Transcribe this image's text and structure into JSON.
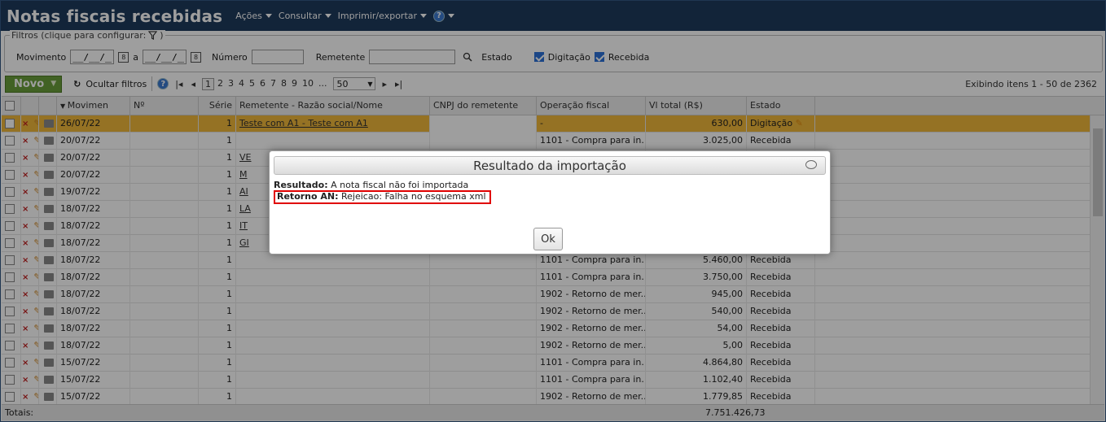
{
  "header": {
    "title": "Notas fiscais recebidas",
    "menus": [
      "Ações",
      "Consultar",
      "Imprimir/exportar"
    ],
    "help_icon": "question-circle-icon"
  },
  "filters": {
    "legend": "Filtros (clique para configurar:",
    "movimento_label": "Movimento",
    "date_from": "__/__/__",
    "a_label": "a",
    "date_to": "__/__/__",
    "numero_label": "Número",
    "numero_value": "",
    "remetente_label": "Remetente",
    "remetente_value": "",
    "estado_label": "Estado",
    "digitacao_label": "Digitação",
    "recebida_label": "Recebida",
    "digitacao_checked": true,
    "recebida_checked": true
  },
  "toolbar": {
    "novo_label": "Novo",
    "ocultar_label": "Ocultar filtros",
    "pages": [
      "1",
      "2",
      "3",
      "4",
      "5",
      "6",
      "7",
      "8",
      "9",
      "10",
      "..."
    ],
    "current_page": "1",
    "page_size": "50",
    "showing": "Exibindo itens 1 - 50 de 2362"
  },
  "table": {
    "headers": [
      "",
      "",
      "",
      "Movimen",
      "Nº",
      "Série",
      "Remetente - Razão social/Nome",
      "CNPJ do remetente",
      "Operação fiscal",
      "Vl total (R$)",
      "Estado"
    ],
    "rows": [
      {
        "date": "26/07/22",
        "serie": "1",
        "remetente": "Teste com A1 - Teste com A1",
        "cnpj": "",
        "operacao": "-",
        "valor": "630,00",
        "estado": "Digitação",
        "selected": true
      },
      {
        "date": "20/07/22",
        "serie": "1",
        "remetente": "",
        "cnpj": "",
        "operacao": "1101 - Compra para in...",
        "valor": "3.025,00",
        "estado": "Recebida"
      },
      {
        "date": "20/07/22",
        "serie": "1",
        "remetente": "VE",
        "cnpj": "",
        "operacao": "",
        "valor": "",
        "estado": ""
      },
      {
        "date": "20/07/22",
        "serie": "1",
        "remetente": "M",
        "cnpj": "",
        "operacao": "",
        "valor": "",
        "estado": ""
      },
      {
        "date": "19/07/22",
        "serie": "1",
        "remetente": "AI",
        "cnpj": "",
        "operacao": "",
        "valor": "",
        "estado": ""
      },
      {
        "date": "18/07/22",
        "serie": "1",
        "remetente": "LA",
        "cnpj": "",
        "operacao": "",
        "valor": "",
        "estado": ""
      },
      {
        "date": "18/07/22",
        "serie": "1",
        "remetente": "IT",
        "cnpj": "",
        "operacao": "",
        "valor": "",
        "estado": ""
      },
      {
        "date": "18/07/22",
        "serie": "1",
        "remetente": "GI",
        "cnpj": "",
        "operacao": "",
        "valor": "",
        "estado": ""
      },
      {
        "date": "18/07/22",
        "serie": "1",
        "remetente": "",
        "cnpj": "",
        "operacao": "1101 - Compra para in...",
        "valor": "5.460,00",
        "estado": "Recebida"
      },
      {
        "date": "18/07/22",
        "serie": "1",
        "remetente": "",
        "cnpj": "",
        "operacao": "1101 - Compra para in...",
        "valor": "3.750,00",
        "estado": "Recebida"
      },
      {
        "date": "18/07/22",
        "serie": "1",
        "remetente": "",
        "cnpj": "",
        "operacao": "1902 - Retorno de mer...",
        "valor": "945,00",
        "estado": "Recebida"
      },
      {
        "date": "18/07/22",
        "serie": "1",
        "remetente": "",
        "cnpj": "",
        "operacao": "1902 - Retorno de mer...",
        "valor": "540,00",
        "estado": "Recebida"
      },
      {
        "date": "18/07/22",
        "serie": "1",
        "remetente": "",
        "cnpj": "",
        "operacao": "1902 - Retorno de mer...",
        "valor": "54,00",
        "estado": "Recebida"
      },
      {
        "date": "18/07/22",
        "serie": "1",
        "remetente": "",
        "cnpj": "",
        "operacao": "1902 - Retorno de mer...",
        "valor": "5,00",
        "estado": "Recebida"
      },
      {
        "date": "15/07/22",
        "serie": "1",
        "remetente": "",
        "cnpj": "",
        "operacao": "1101 - Compra para in...",
        "valor": "4.864,80",
        "estado": "Recebida"
      },
      {
        "date": "15/07/22",
        "serie": "1",
        "remetente": "",
        "cnpj": "",
        "operacao": "1101 - Compra para in...",
        "valor": "1.102,40",
        "estado": "Recebida"
      },
      {
        "date": "15/07/22",
        "serie": "1",
        "remetente": "",
        "cnpj": "",
        "operacao": "1902 - Retorno de mer...",
        "valor": "1.779,85",
        "estado": "Recebida"
      }
    ],
    "totals_label": "Totais:",
    "totals_value": "7.751.426,73"
  },
  "dialog": {
    "title": "Resultado da importação",
    "resultado_label": "Resultado:",
    "resultado_text": "A nota fiscal não foi importada",
    "retorno_label": "Retorno AN:",
    "retorno_text": "Rejeicao: Falha no esquema xml",
    "ok_label": "Ok"
  },
  "colors": {
    "header_bg": "#1e3a5c",
    "novo_bg": "#6a9e3a",
    "selected_row": "#f0b83a",
    "highlight_border": "#e00000"
  }
}
